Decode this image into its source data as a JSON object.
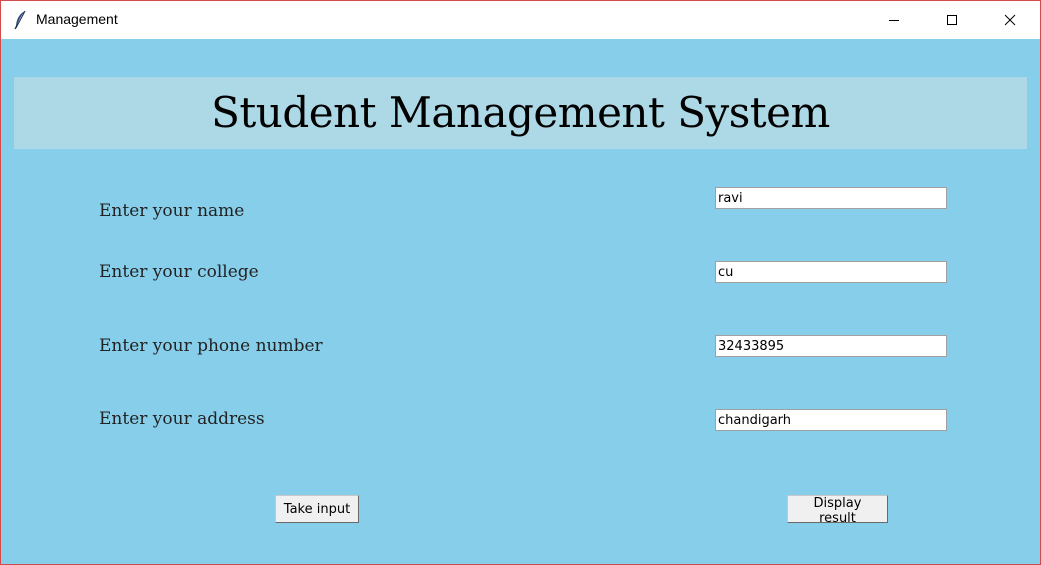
{
  "window": {
    "title": "Management",
    "icons": {
      "app": "feather-icon",
      "minimize": "minimize-icon",
      "maximize": "maximize-icon",
      "close": "close-icon"
    }
  },
  "main": {
    "heading": "Student Management System",
    "fields": [
      {
        "label": "Enter your name",
        "value": "ravi"
      },
      {
        "label": "Enter your college",
        "value": "cu"
      },
      {
        "label": "Enter your phone number",
        "value": "32433895"
      },
      {
        "label": "Enter your address",
        "value": "chandigarh"
      }
    ],
    "buttons": {
      "take_input": "Take input",
      "display_result": "Display result"
    }
  },
  "colors": {
    "background": "#87ceeb",
    "heading_band": "#add8e6",
    "titlebar": "#ffffff",
    "window_border": "#d24a4a"
  }
}
